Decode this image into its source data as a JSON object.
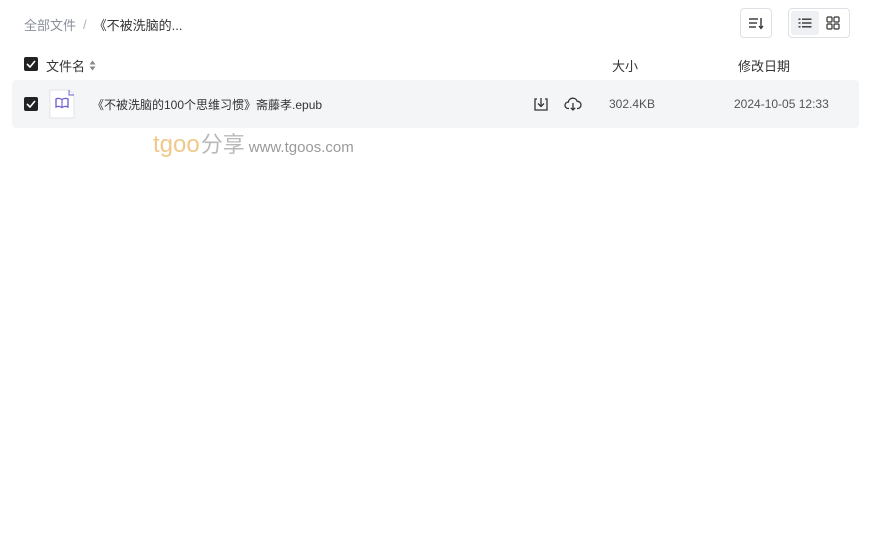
{
  "breadcrumb": {
    "root": "全部文件",
    "separator": "/",
    "current": "《不被洗脑的..."
  },
  "toolbar": {
    "sort_icon": "sort-lines-icon",
    "views": [
      {
        "name": "list-view",
        "icon": "list-icon",
        "active": true
      },
      {
        "name": "grid-view",
        "icon": "grid-icon",
        "active": false
      }
    ]
  },
  "table": {
    "columns": {
      "name": "文件名",
      "size": "大小",
      "date": "修改日期"
    },
    "rows": [
      {
        "name": "《不被洗脑的100个思维习惯》斋藤孝.epub",
        "size": "302.4KB",
        "date": "2024-10-05 12:33",
        "checked": true,
        "icon": "epub-book-icon"
      }
    ]
  },
  "watermark": {
    "brand": "tgoo",
    "brand_cn": "分享",
    "url": "www.tgoos.com"
  },
  "colors": {
    "row_bg": "#f4f5f7",
    "accent_purple": "#6b5bd6",
    "checkbox": "#222222"
  }
}
